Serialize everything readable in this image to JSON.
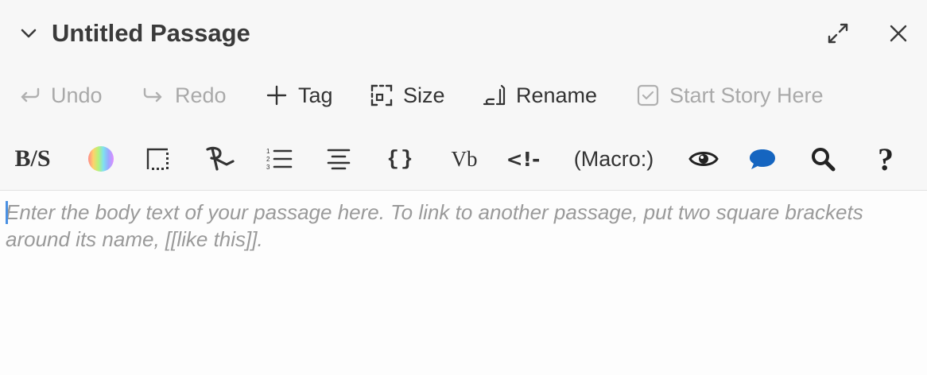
{
  "dialog": {
    "title": "Untitled Passage",
    "collapse_icon": "chevron-down-icon",
    "maximize_icon": "expand-arrows-icon",
    "close_icon": "close-icon"
  },
  "actions": {
    "undo": {
      "label": "Undo",
      "icon": "undo-icon",
      "enabled": false
    },
    "redo": {
      "label": "Redo",
      "icon": "redo-icon",
      "enabled": false
    },
    "tag": {
      "label": "Tag",
      "icon": "plus-icon",
      "enabled": true
    },
    "size": {
      "label": "Size",
      "icon": "size-icon",
      "enabled": true
    },
    "rename": {
      "label": "Rename",
      "icon": "rename-icon",
      "enabled": true
    },
    "start_story": {
      "label": "Start Story Here",
      "icon": "checkbox-icon",
      "enabled": false
    }
  },
  "toolbar": {
    "bold_italic_strike": "B/S",
    "colours_icon": "rainbow-circle-icon",
    "borders_icon": "border-box-icon",
    "special_text_icon": "r-special-icon",
    "lists_icon": "numbered-list-icon",
    "align_icon": "align-center-icon",
    "code_label": "{}",
    "variable_label": "Vb",
    "comment_label": "<!-",
    "macro_label": "(Macro:)",
    "preview_icon": "eye-icon",
    "chat_icon": "speech-bubble-icon",
    "search_icon": "magnifier-icon",
    "help_label": "?",
    "accent_blue": "#1565c0"
  },
  "editor": {
    "placeholder": "Enter the body text of your passage here. To link to another passage, put two square brackets around its name, [[like this]].",
    "value": ""
  }
}
